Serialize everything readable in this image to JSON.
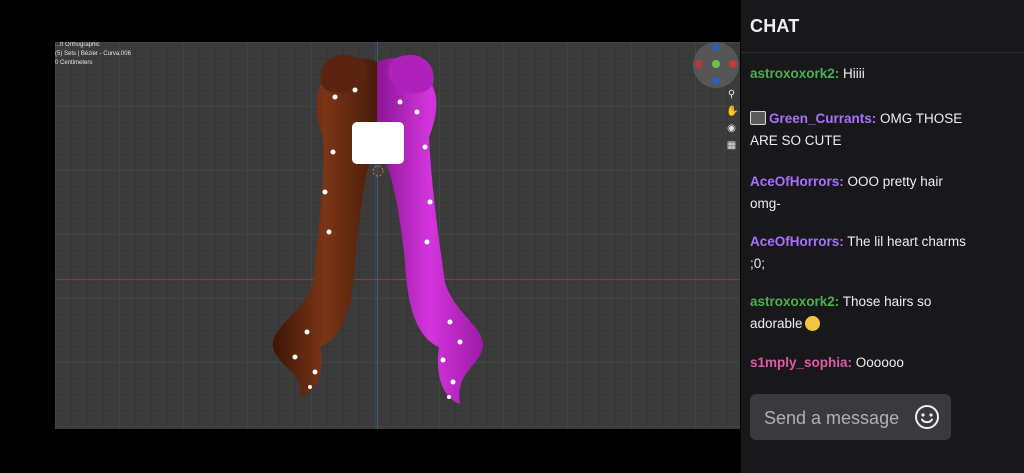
{
  "viewport": {
    "view_mode": "...ft Orthographic",
    "selection_info": "(5) Sets | Bézier - Curva.006",
    "units": "0 Centimeters",
    "tools": [
      "zoom-icon",
      "hand-icon",
      "camera-icon",
      "grid-icon"
    ]
  },
  "chat": {
    "title": "CHAT",
    "messages": [
      {
        "user": "astroxoxork2",
        "color": "#4caf50",
        "separator": ":",
        "text": " Hiiii",
        "badge": false
      },
      {
        "user": "Green_Currants",
        "color": "#a970ff",
        "separator": ":",
        "text": " OMG THOSE ARE SO CUTE",
        "badge": true
      },
      {
        "user": "AceOfHorrors",
        "color": "#a970ff",
        "separator": ":",
        "text": " OOO pretty hair omg-",
        "badge": false
      },
      {
        "user": "AceOfHorrors",
        "color": "#a970ff",
        "separator": ":",
        "text": " The lil heart charms ;0;",
        "badge": false
      },
      {
        "user": "astroxoxork2",
        "color": "#4caf50",
        "separator": ":",
        "text": " Those hairs so adorable",
        "badge": false,
        "emoji": "crying-face-emoji"
      },
      {
        "user": "s1mply_sophia",
        "color": "#e05ba8",
        "separator": ":",
        "text": " Oooooo",
        "badge": false
      }
    ],
    "input": {
      "placeholder": "Send a message",
      "value": ""
    },
    "emoji_button_icon": "smiley-icon"
  },
  "colors": {
    "chat_bg": "#18181b",
    "viewport_bg": "#3b3b3b",
    "hair_brown": "#6b2c10",
    "hair_magenta": "#c026c9"
  }
}
